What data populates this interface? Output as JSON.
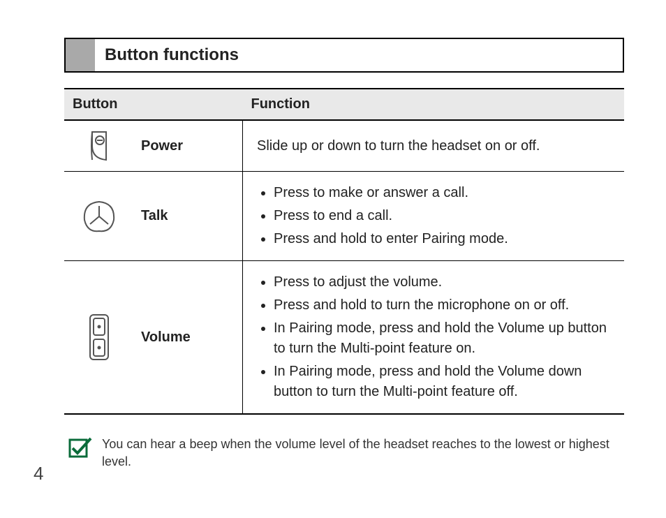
{
  "heading": "Button functions",
  "table": {
    "headers": {
      "button": "Button",
      "function": "Function"
    },
    "rows": [
      {
        "label": "Power",
        "single_text": "Slide up or down to turn the headset on or off."
      },
      {
        "label": "Talk",
        "bullets": [
          "Press to make or answer a call.",
          "Press to end a call.",
          "Press and hold to enter Pairing mode."
        ]
      },
      {
        "label": "Volume",
        "bullets": [
          "Press to adjust the volume.",
          "Press and hold to turn the microphone on or off.",
          "In Pairing mode, press and hold the Volume up button to turn the Multi-point feature on.",
          "In Pairing mode, press and hold the Volume down button to turn the Multi-point feature off."
        ]
      }
    ]
  },
  "note": "You can hear a beep when the volume level of the headset reaches to the lowest or highest level.",
  "page_number": "4"
}
